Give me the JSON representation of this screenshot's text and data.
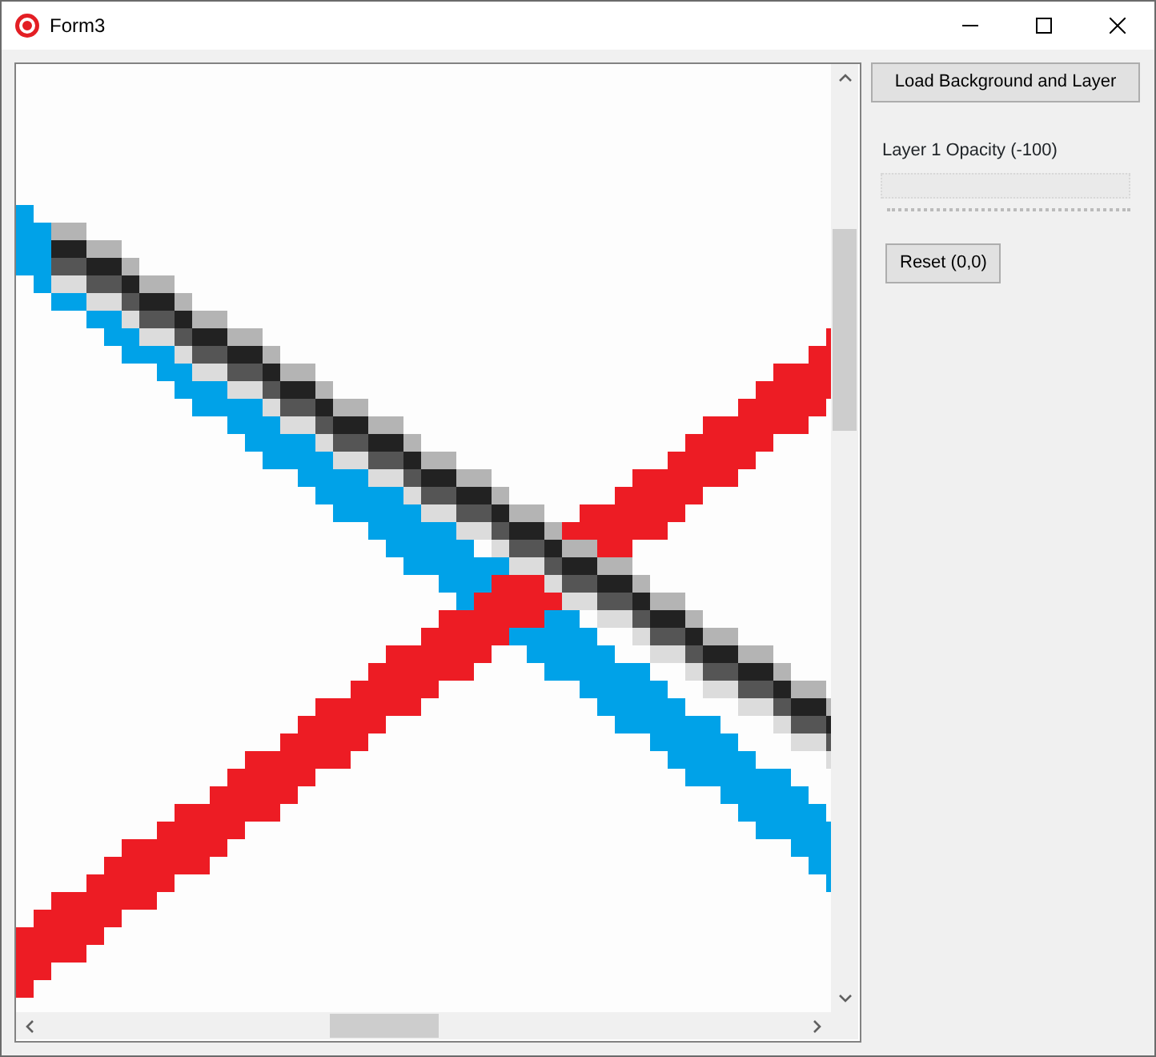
{
  "window": {
    "title": "Form3"
  },
  "side_panel": {
    "load_button": "Load Background and Layer",
    "opacity_label": "Layer 1 Opacity (-100)",
    "opacity_slider": {
      "disabled": true
    },
    "reset_button": "Reset (0,0)"
  }
}
